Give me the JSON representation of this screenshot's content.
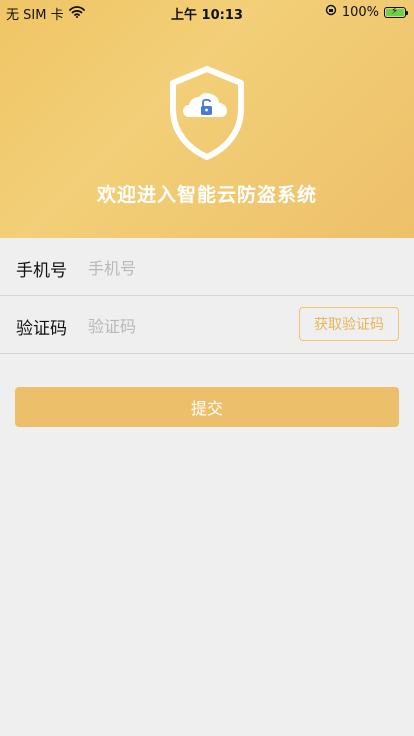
{
  "status_bar": {
    "carrier": "无 SIM 卡",
    "time": "上午 10:13",
    "battery": "100%"
  },
  "header": {
    "welcome": "欢迎进入智能云防盗系统",
    "icon": "shield-cloud-lock-icon",
    "bg_color": "#f0c565"
  },
  "form": {
    "phone": {
      "label": "手机号",
      "placeholder": "手机号",
      "value": ""
    },
    "code": {
      "label": "验证码",
      "placeholder": "验证码",
      "value": "",
      "button": "获取验证码"
    }
  },
  "submit_label": "提交",
  "colors": {
    "accent": "#ecc06a",
    "accent_text": "#e6b65a",
    "background": "#efefef"
  }
}
